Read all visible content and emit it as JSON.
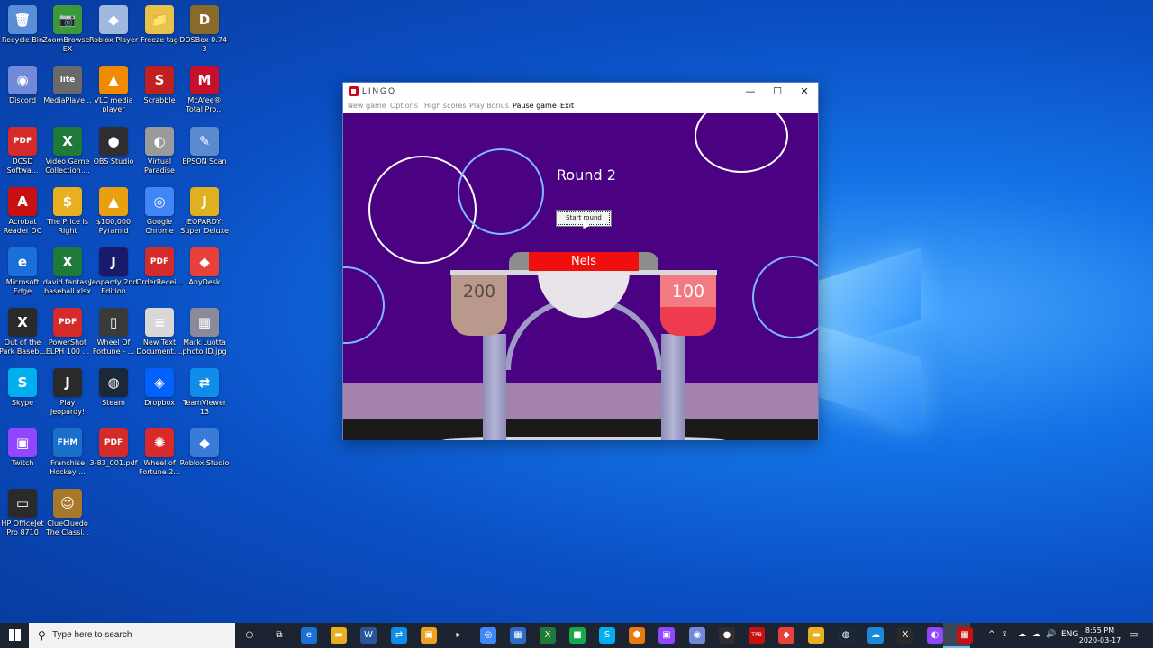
{
  "desktop": {
    "icons": [
      {
        "label": "Recycle Bin",
        "glyph": "🗑",
        "color": "#5a8fd8"
      },
      {
        "label": "ZoomBrowser EX",
        "glyph": "📷",
        "color": "#3a9a3a"
      },
      {
        "label": "Roblox Player",
        "glyph": "◆",
        "color": "#9fb8e0"
      },
      {
        "label": "Freeze tag",
        "glyph": "📁",
        "color": "#e8c04a"
      },
      {
        "label": "DOSBox 0.74-3",
        "glyph": "D",
        "color": "#8a6a2a"
      },
      {
        "label": "Discord",
        "glyph": "◉",
        "color": "#7289da"
      },
      {
        "label": "MediaPlaye...",
        "glyph": "lite",
        "color": "#6a6a6a"
      },
      {
        "label": "VLC media player",
        "glyph": "▲",
        "color": "#f08a00"
      },
      {
        "label": "Scrabble",
        "glyph": "S",
        "color": "#c02020"
      },
      {
        "label": "McAfee® Total Pro...",
        "glyph": "M",
        "color": "#c8102e"
      },
      {
        "label": "DCSD Softwa...",
        "glyph": "PDF",
        "color": "#d42a2a"
      },
      {
        "label": "Video Game Collection....",
        "glyph": "X",
        "color": "#1f7a3a"
      },
      {
        "label": "OBS Studio",
        "glyph": "●",
        "color": "#302e31"
      },
      {
        "label": "Virtual Paradise",
        "glyph": "◐",
        "color": "#9a9a9a"
      },
      {
        "label": "EPSON Scan",
        "glyph": "✎",
        "color": "#5a8ad0"
      },
      {
        "label": "Acrobat Reader DC",
        "glyph": "A",
        "color": "#c81010"
      },
      {
        "label": "The Price Is Right",
        "glyph": "$",
        "color": "#e8b020"
      },
      {
        "label": "$100,000 Pyramid",
        "glyph": "▲",
        "color": "#e8a010"
      },
      {
        "label": "Google Chrome",
        "glyph": "◎",
        "color": "#4285f4"
      },
      {
        "label": "JEOPARDY! Super Deluxe",
        "glyph": "J",
        "color": "#e0b020"
      },
      {
        "label": "Microsoft Edge",
        "glyph": "e",
        "color": "#1a70d8"
      },
      {
        "label": "david fantasy baseball.xlsx",
        "glyph": "X",
        "color": "#1f7a3a"
      },
      {
        "label": "Jeopardy 2nd Edition",
        "glyph": "J",
        "color": "#1a1a6a"
      },
      {
        "label": "OrderRecei...",
        "glyph": "PDF",
        "color": "#d42a2a"
      },
      {
        "label": "AnyDesk",
        "glyph": "◆",
        "color": "#e8413b"
      },
      {
        "label": "Out of the Park Baseb...",
        "glyph": "X",
        "color": "#2a2a2a"
      },
      {
        "label": "PowerShot ELPH 100 ...",
        "glyph": "PDF",
        "color": "#d42a2a"
      },
      {
        "label": "Wheel Of Fortune - ...",
        "glyph": "▯",
        "color": "#3a3a3a"
      },
      {
        "label": "New Text Document....",
        "glyph": "≡",
        "color": "#d8d8d8"
      },
      {
        "label": "Mark Luotta photo ID.jpg",
        "glyph": "▦",
        "color": "#8a8a9a"
      },
      {
        "label": "Skype",
        "glyph": "S",
        "color": "#00aff0"
      },
      {
        "label": "Play Jeopardy!",
        "glyph": "J",
        "color": "#2a2a2a"
      },
      {
        "label": "Steam",
        "glyph": "◍",
        "color": "#1b2838"
      },
      {
        "label": "Dropbox",
        "glyph": "◈",
        "color": "#0061ff"
      },
      {
        "label": "TeamViewer 13",
        "glyph": "⇄",
        "color": "#0e8ee9"
      },
      {
        "label": "Twitch",
        "glyph": "▣",
        "color": "#9146ff"
      },
      {
        "label": "Franchise Hockey ...",
        "glyph": "FHM",
        "color": "#1a70c8"
      },
      {
        "label": "3-83_001.pdf",
        "glyph": "PDF",
        "color": "#d42a2a"
      },
      {
        "label": "Wheel of Fortune 2...",
        "glyph": "✺",
        "color": "#d82a2a"
      },
      {
        "label": "Roblox Studio",
        "glyph": "◆",
        "color": "#3a7ad8"
      },
      {
        "label": "HP OfficeJet Pro 8710",
        "glyph": "▭",
        "color": "#2a2a2a"
      },
      {
        "label": "ClueCluedo The Classi...",
        "glyph": "☺",
        "color": "#a8782a"
      }
    ]
  },
  "window": {
    "title": "LINGO",
    "minimize": "—",
    "maximize": "☐",
    "close": "✕",
    "menu": [
      {
        "label": "New game",
        "active": false
      },
      {
        "label": "Options",
        "active": false
      },
      {
        "label": "High scores",
        "active": false
      },
      {
        "label": "Play Bonus",
        "active": false
      },
      {
        "label": "Pause game",
        "active": true
      },
      {
        "label": "Exit",
        "active": true
      }
    ]
  },
  "game": {
    "round_text": "Round 2",
    "start_button": "Start round",
    "player_name": "Nels",
    "score_left": "200",
    "score_right": "100",
    "colors": {
      "background": "#4b0282",
      "name_plate": "#ef0f0f",
      "score_left": "#b8998c",
      "score_right": "#ee3b50"
    }
  },
  "taskbar": {
    "search_placeholder": "Type here to search",
    "search_icon": "⚲",
    "pinned": [
      {
        "name": "task-view",
        "glyph": "○",
        "color": "transparent"
      },
      {
        "name": "timeline",
        "glyph": "⧉",
        "color": "transparent"
      },
      {
        "name": "edge",
        "glyph": "e",
        "color": "#1a70d8"
      },
      {
        "name": "file-explorer",
        "glyph": "▬",
        "color": "#e8b020"
      },
      {
        "name": "word",
        "glyph": "W",
        "color": "#2b579a"
      },
      {
        "name": "teamviewer",
        "glyph": "⇄",
        "color": "#0e8ee9"
      },
      {
        "name": "outlook",
        "glyph": "▣",
        "color": "#f0a020"
      },
      {
        "name": "arrow-app",
        "glyph": "▸",
        "color": "transparent"
      },
      {
        "name": "chrome",
        "glyph": "◎",
        "color": "#4285f4"
      },
      {
        "name": "store",
        "glyph": "▦",
        "color": "#2a6ac8"
      },
      {
        "name": "excel",
        "glyph": "X",
        "color": "#1f7a3a"
      },
      {
        "name": "media",
        "glyph": "■",
        "color": "#1aa84a"
      },
      {
        "name": "skype",
        "glyph": "S",
        "color": "#00aff0"
      },
      {
        "name": "shield-app",
        "glyph": "⬢",
        "color": "#e87a10"
      },
      {
        "name": "twitch",
        "glyph": "▣",
        "color": "#9146ff"
      },
      {
        "name": "discord",
        "glyph": "◉",
        "color": "#7289da"
      },
      {
        "name": "obs",
        "glyph": "●",
        "color": "#302e31"
      },
      {
        "name": "tpb",
        "glyph": "TPB",
        "color": "#c81010"
      },
      {
        "name": "anydesk",
        "glyph": "◆",
        "color": "#e8413b"
      },
      {
        "name": "folder",
        "glyph": "▬",
        "color": "#e8b020"
      },
      {
        "name": "steam",
        "glyph": "◍",
        "color": "#1b2838"
      },
      {
        "name": "cloud-app",
        "glyph": "☁",
        "color": "#1a8ad8"
      },
      {
        "name": "x-app",
        "glyph": "X",
        "color": "#2a2a2a"
      },
      {
        "name": "twitch-2",
        "glyph": "◐",
        "color": "#9146ff"
      },
      {
        "name": "lingo",
        "glyph": "▦",
        "color": "#c81010"
      }
    ],
    "tray": {
      "chevron": "^",
      "lang": "ENG",
      "time": "8:55 PM",
      "date": "2020-03-17"
    }
  }
}
